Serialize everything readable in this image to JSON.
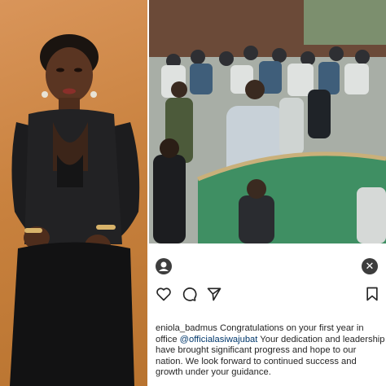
{
  "post": {
    "username": "eniola_badmus",
    "caption_part1": "Congratulations on your first year in office",
    "mention": "@officialasiwajubat",
    "caption_part2": "Your dedication and leadership have brought significant progress and hope to our nation. We look forward to continued success and growth under your guidance."
  },
  "icons": {
    "avatar": "profile-avatar-icon",
    "close": "close-icon",
    "like": "heart-icon",
    "comment": "comment-icon",
    "share": "send-icon",
    "save": "bookmark-icon"
  },
  "colors": {
    "portrait_background": "#c9823f",
    "mention": "#00376b",
    "text": "#262626",
    "assembly_green": "#3f8f63"
  }
}
